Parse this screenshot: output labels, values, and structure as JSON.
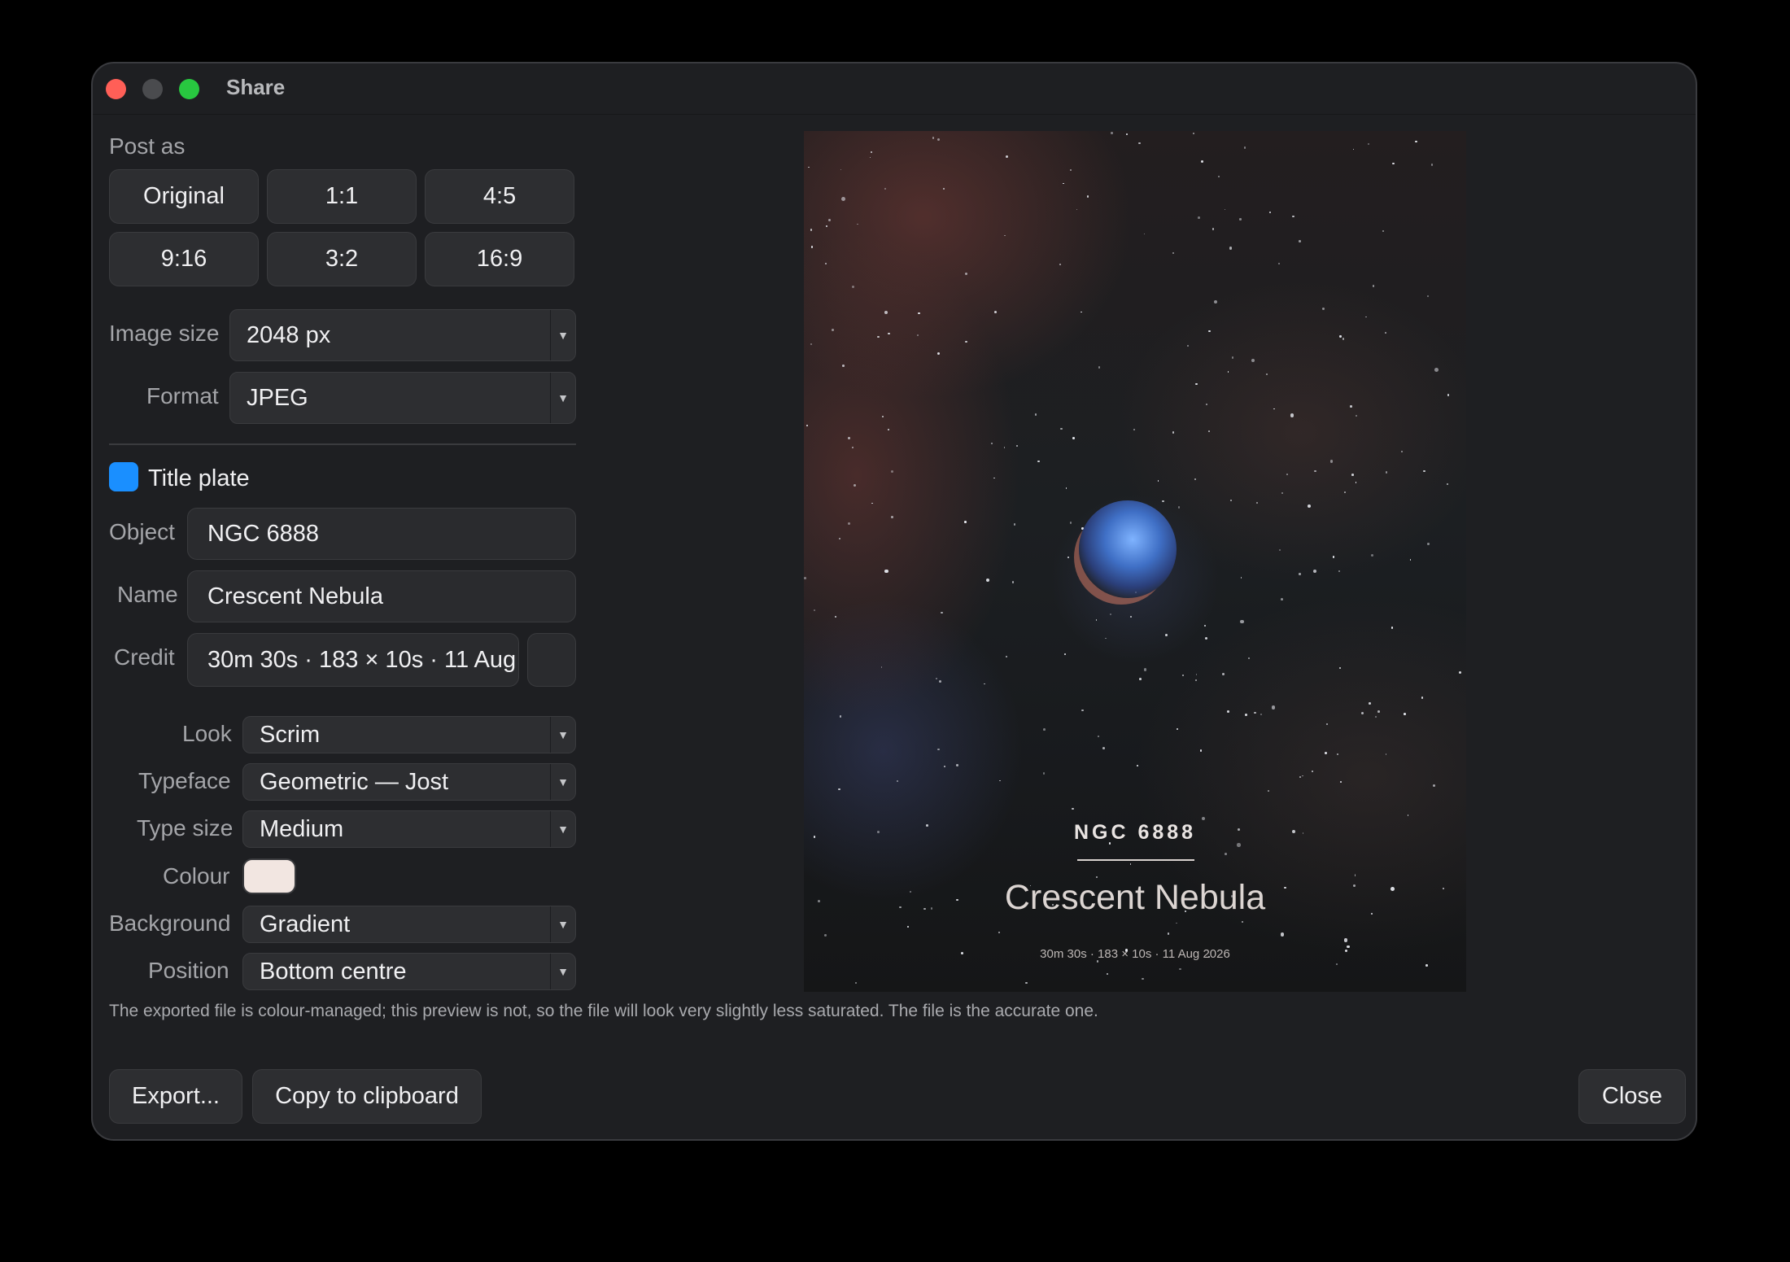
{
  "window": {
    "title": "Share"
  },
  "post_as": {
    "label": "Post as",
    "options": [
      "Original",
      "1:1",
      "4:5",
      "9:16",
      "3:2",
      "16:9"
    ]
  },
  "image_size": {
    "label": "Image size",
    "value": "2048 px"
  },
  "format": {
    "label": "Format",
    "value": "JPEG"
  },
  "title_plate": {
    "label": "Title plate",
    "checked": true,
    "object": {
      "label": "Object",
      "value": "NGC 6888"
    },
    "name": {
      "label": "Name",
      "value": "Crescent Nebula"
    },
    "credit": {
      "label": "Credit",
      "value": "30m 30s · 183 × 10s · 11 Aug"
    }
  },
  "look": {
    "label": "Look",
    "value": "Scrim"
  },
  "typeface": {
    "label": "Typeface",
    "value": "Geometric — Jost"
  },
  "type_size": {
    "label": "Type size",
    "value": "Medium"
  },
  "colour": {
    "label": "Colour",
    "value": "#f2e6e1"
  },
  "background": {
    "label": "Background",
    "value": "Gradient"
  },
  "position": {
    "label": "Position",
    "value": "Bottom centre"
  },
  "preview": {
    "object": "NGC 6888",
    "name": "Crescent Nebula",
    "credit": "30m 30s · 183 × 10s · 11 Aug 2026"
  },
  "note": "The exported file is colour-managed; this preview is not, so the file will look very slightly less saturated. The file is the accurate one.",
  "buttons": {
    "export": "Export...",
    "copy": "Copy to clipboard",
    "close": "Close"
  }
}
